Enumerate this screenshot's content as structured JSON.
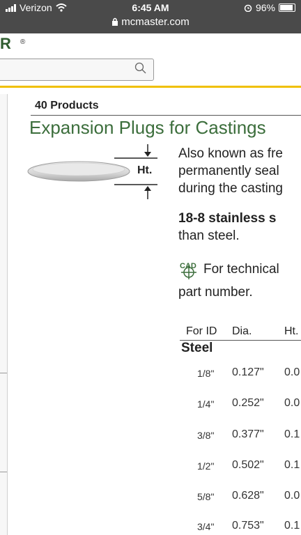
{
  "status_bar": {
    "carrier": "Verizon",
    "time": "6:45 AM",
    "battery": "96%",
    "url": "mcmaster.com"
  },
  "header": {
    "logo_text": "R",
    "registered_mark": "®",
    "search": {
      "value": "",
      "placeholder": ""
    }
  },
  "product": {
    "count_label": "40 Products",
    "title": "Expansion Plugs for Castings",
    "diagram_label": "Ht.",
    "description_lines": [
      "Also known as fre",
      "permanently seal",
      "during the casting"
    ],
    "material_bold": "18-8 stainless s",
    "material_rest": "than steel.",
    "cad_text_line1": "For technical",
    "cad_text_line2": "part number.",
    "cad_icon_label": "CAD"
  },
  "table": {
    "headers": [
      "For ID",
      "Dia.",
      "Ht."
    ],
    "group": "Steel",
    "rows": [
      {
        "for_id": "1/8\"",
        "dia": "0.127\"",
        "ht": "0.0"
      },
      {
        "for_id": "1/4\"",
        "dia": "0.252\"",
        "ht": "0.0"
      },
      {
        "for_id": "3/8\"",
        "dia": "0.377\"",
        "ht": "0.1"
      },
      {
        "for_id": "1/2\"",
        "dia": "0.502\"",
        "ht": "0.1"
      },
      {
        "for_id": "5/8\"",
        "dia": "0.628\"",
        "ht": "0.0"
      },
      {
        "for_id": "3/4\"",
        "dia": "0.753\"",
        "ht": "0.1"
      }
    ]
  },
  "colors": {
    "accent_yellow": "#f0c000",
    "title_green": "#3c6e3c",
    "status_bar": "#4a4a4a"
  }
}
